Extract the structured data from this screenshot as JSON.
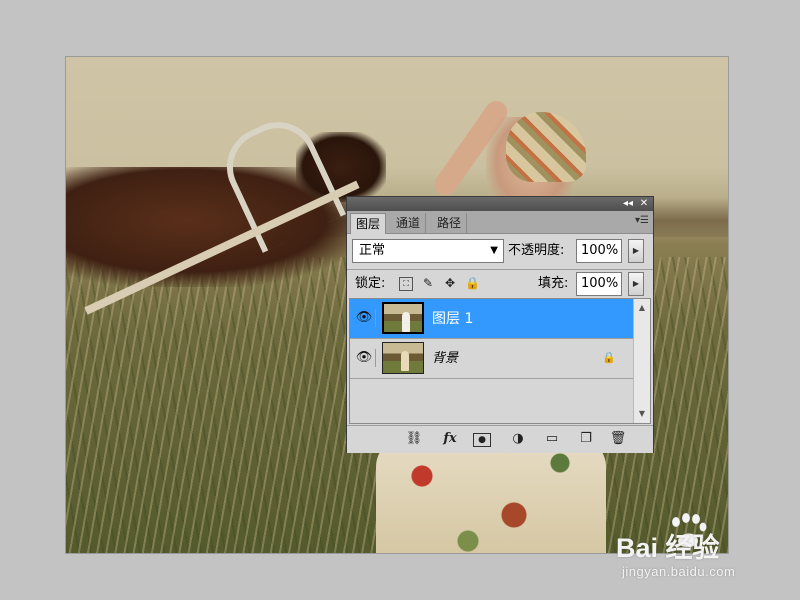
{
  "panel": {
    "collapse_icon": "double-chevron-left-icon",
    "close_label": "✕",
    "tabs": [
      {
        "label": "图层",
        "active": true
      },
      {
        "label": "通道",
        "active": false
      },
      {
        "label": "路径",
        "active": false
      }
    ],
    "blend_mode": "正常",
    "opacity_label": "不透明度:",
    "opacity_value": "100%",
    "lock_label": "锁定:",
    "fill_label": "填充:",
    "fill_value": "100%",
    "layers": [
      {
        "name": "图层 1",
        "selected": true,
        "visible": true,
        "locked": false
      },
      {
        "name": "背景",
        "selected": false,
        "visible": true,
        "locked": true
      }
    ],
    "footer_icons": [
      "link-icon",
      "fx-icon",
      "mask-icon",
      "adjustment-icon",
      "folder-icon",
      "new-layer-icon",
      "trash-icon"
    ],
    "selection_color": "#3399ff"
  },
  "watermark": {
    "brand": "Bai  经验",
    "url": "jingyan.baidu.com"
  }
}
